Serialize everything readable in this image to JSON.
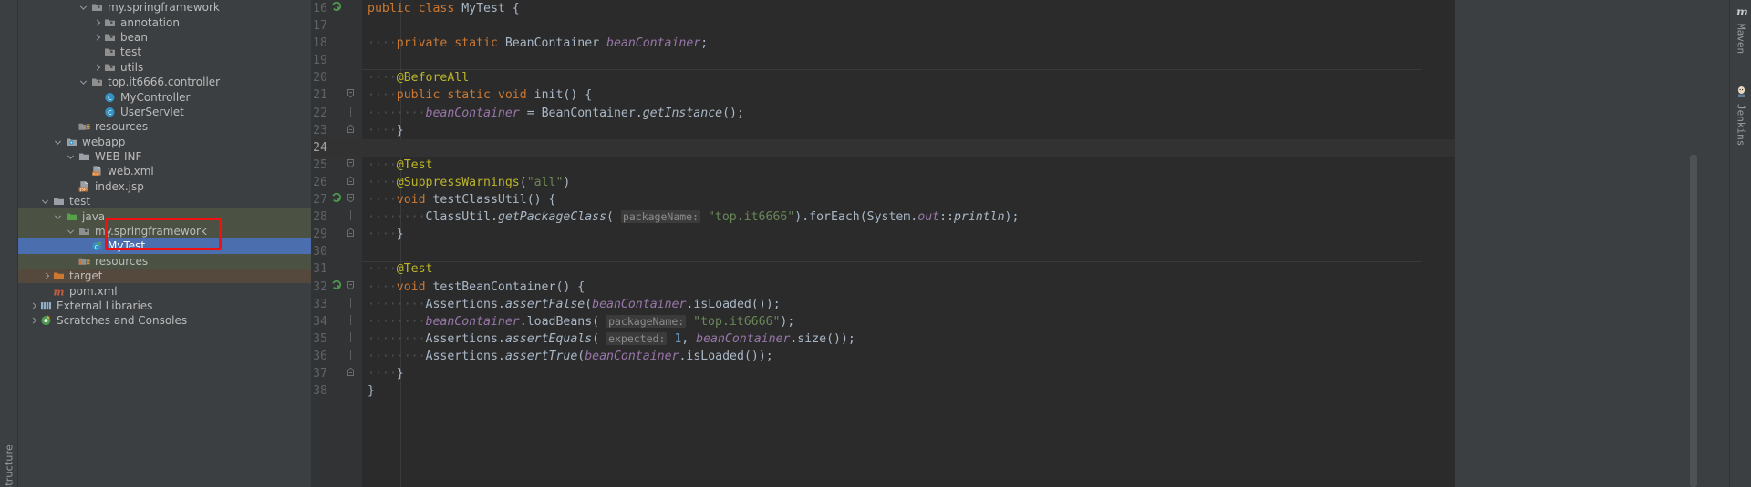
{
  "left_strip": {
    "structure_label": "Structure"
  },
  "project_tree": {
    "items": [
      {
        "indent": 4,
        "arrow": "open",
        "icon": "package-icon",
        "label": "my.springframework",
        "scope": "none",
        "selected": false
      },
      {
        "indent": 5,
        "arrow": "closed",
        "icon": "package-icon",
        "label": "annotation",
        "scope": "none",
        "selected": false
      },
      {
        "indent": 5,
        "arrow": "closed",
        "icon": "package-icon",
        "label": "bean",
        "scope": "none",
        "selected": false
      },
      {
        "indent": 5,
        "arrow": "none",
        "icon": "package-icon",
        "label": "test",
        "scope": "none",
        "selected": false
      },
      {
        "indent": 5,
        "arrow": "closed",
        "icon": "package-icon",
        "label": "utils",
        "scope": "none",
        "selected": false
      },
      {
        "indent": 4,
        "arrow": "open",
        "icon": "package-icon",
        "label": "top.it6666.controller",
        "scope": "none",
        "selected": false
      },
      {
        "indent": 5,
        "arrow": "none",
        "icon": "class-icon",
        "label": "MyController",
        "scope": "none",
        "selected": false
      },
      {
        "indent": 5,
        "arrow": "none",
        "icon": "class-icon",
        "label": "UserServlet",
        "scope": "none",
        "selected": false
      },
      {
        "indent": 3,
        "arrow": "none",
        "icon": "resources-icon",
        "label": "resources",
        "scope": "none",
        "selected": false
      },
      {
        "indent": 2,
        "arrow": "open",
        "icon": "webapp-icon",
        "label": "webapp",
        "scope": "none",
        "selected": false
      },
      {
        "indent": 3,
        "arrow": "open",
        "icon": "folder-icon",
        "label": "WEB-INF",
        "scope": "none",
        "selected": false
      },
      {
        "indent": 4,
        "arrow": "none",
        "icon": "xml-file-icon",
        "label": "web.xml",
        "scope": "none",
        "selected": false
      },
      {
        "indent": 3,
        "arrow": "none",
        "icon": "jsp-file-icon",
        "label": "index.jsp",
        "scope": "none",
        "selected": false
      },
      {
        "indent": 1,
        "arrow": "open",
        "icon": "folder-icon",
        "label": "test",
        "scope": "none",
        "selected": false
      },
      {
        "indent": 2,
        "arrow": "open",
        "icon": "source-root-icon",
        "label": "java",
        "scope": "test",
        "selected": false
      },
      {
        "indent": 3,
        "arrow": "open",
        "icon": "package-icon",
        "label": "my.springframework",
        "scope": "test",
        "selected": false
      },
      {
        "indent": 4,
        "arrow": "none",
        "icon": "test-class-icon",
        "label": "MyTest",
        "scope": "test",
        "selected": true
      },
      {
        "indent": 3,
        "arrow": "none",
        "icon": "test-resources-icon",
        "label": "resources",
        "scope": "test",
        "selected": false
      },
      {
        "indent": 1,
        "arrow": "closed",
        "icon": "excluded-folder-icon",
        "label": "target",
        "scope": "target",
        "selected": false
      },
      {
        "indent": 1,
        "arrow": "none",
        "icon": "maven-file-icon",
        "label": "pom.xml",
        "scope": "none",
        "selected": false
      },
      {
        "indent": 0,
        "arrow": "closed",
        "icon": "library-icon",
        "label": "External Libraries",
        "scope": "none",
        "selected": false
      },
      {
        "indent": 0,
        "arrow": "closed",
        "icon": "scratches-icon",
        "label": "Scratches and Consoles",
        "scope": "none",
        "selected": false
      }
    ],
    "annotation": {
      "type": "red-rectangle",
      "color": "#ee1111"
    }
  },
  "editor": {
    "caret_line": 24,
    "first_line": 16,
    "lines": [
      {
        "n": 16,
        "run": true,
        "fold": "none",
        "html": "<span class=\"kw\">public class </span><span class=\"cls\">MyTest </span><span class=\"punc\">{</span>"
      },
      {
        "n": 17,
        "run": false,
        "fold": "none",
        "html": ""
      },
      {
        "n": 18,
        "run": false,
        "fold": "none",
        "html": "<span class=\"ind\">····</span><span class=\"kw\">private static </span><span class=\"cls\">BeanContainer </span><span class=\"fld\">beanContainer</span><span class=\"punc\">;</span>"
      },
      {
        "n": 19,
        "run": false,
        "fold": "none",
        "html": ""
      },
      {
        "n": 20,
        "run": false,
        "fold": "none",
        "html": "<span class=\"ind\">····</span><span class=\"ann\">@BeforeAll</span>"
      },
      {
        "n": 21,
        "run": false,
        "fold": "open",
        "html": "<span class=\"ind\">····</span><span class=\"kw\">public static void </span><span class=\"cls\">init</span><span class=\"punc\">() {</span>"
      },
      {
        "n": 22,
        "run": false,
        "fold": "bar",
        "html": "<span class=\"ind\">····</span><span class=\"ind\">····</span><span class=\"fld\">beanContainer</span><span class=\"punc\"> = </span><span class=\"cls\">BeanContainer.</span><span class=\"mth\">getInstance</span><span class=\"punc\">();</span>"
      },
      {
        "n": 23,
        "run": false,
        "fold": "close",
        "html": "<span class=\"ind\">····</span><span class=\"punc\">}</span>"
      },
      {
        "n": 24,
        "run": false,
        "fold": "none",
        "html": ""
      },
      {
        "n": 25,
        "run": false,
        "fold": "open",
        "html": "<span class=\"ind\">····</span><span class=\"ann\">@Test</span>"
      },
      {
        "n": 26,
        "run": false,
        "fold": "close",
        "html": "<span class=\"ind\">····</span><span class=\"ann\">@SuppressWarnings</span><span class=\"punc\">(</span><span class=\"str\">\"all\"</span><span class=\"punc\">)</span>"
      },
      {
        "n": 27,
        "run": true,
        "fold": "open",
        "html": "<span class=\"ind\">····</span><span class=\"kw\">void </span><span class=\"cls\">testClassUtil</span><span class=\"punc\">() {</span>"
      },
      {
        "n": 28,
        "run": false,
        "fold": "bar",
        "html": "<span class=\"ind\">····</span><span class=\"ind\">····</span><span class=\"cls\">ClassUtil.</span><span class=\"mth\">getPackageClass</span><span class=\"punc\">(</span> <span class=\"hint\">packageName:</span> <span class=\"str\">\"top.it6666\"</span><span class=\"punc\">).forEach(</span><span class=\"cls\">System.</span><span class=\"fld\">out</span><span class=\"punc\">::</span><span class=\"mth\">println</span><span class=\"punc\">);</span>"
      },
      {
        "n": 29,
        "run": false,
        "fold": "close",
        "html": "<span class=\"ind\">····</span><span class=\"punc\">}</span>"
      },
      {
        "n": 30,
        "run": false,
        "fold": "none",
        "html": ""
      },
      {
        "n": 31,
        "run": false,
        "fold": "none",
        "html": "<span class=\"ind\">····</span><span class=\"ann\">@Test</span>"
      },
      {
        "n": 32,
        "run": true,
        "fold": "open",
        "html": "<span class=\"ind\">····</span><span class=\"kw\">void </span><span class=\"cls\">testBeanContainer</span><span class=\"punc\">() {</span>"
      },
      {
        "n": 33,
        "run": false,
        "fold": "bar",
        "html": "<span class=\"ind\">····</span><span class=\"ind\">····</span><span class=\"cls\">Assertions.</span><span class=\"mth\">assertFalse</span><span class=\"punc\">(</span><span class=\"fld\">beanContainer</span><span class=\"punc\">.</span><span class=\"cls\">isLoaded</span><span class=\"punc\">());</span>"
      },
      {
        "n": 34,
        "run": false,
        "fold": "bar",
        "html": "<span class=\"ind\">····</span><span class=\"ind\">····</span><span class=\"fld\">beanContainer</span><span class=\"punc\">.</span><span class=\"cls\">loadBeans</span><span class=\"punc\">(</span> <span class=\"hint\">packageName:</span> <span class=\"str\">\"top.it6666\"</span><span class=\"punc\">);</span>"
      },
      {
        "n": 35,
        "run": false,
        "fold": "bar",
        "html": "<span class=\"ind\">····</span><span class=\"ind\">····</span><span class=\"cls\">Assertions.</span><span class=\"mth\">assertEquals</span><span class=\"punc\">(</span> <span class=\"hint\">expected:</span> <span class=\"num2\">1</span><span class=\"punc\">, </span><span class=\"fld\">beanContainer</span><span class=\"punc\">.</span><span class=\"cls\">size</span><span class=\"punc\">());</span>"
      },
      {
        "n": 36,
        "run": false,
        "fold": "bar",
        "html": "<span class=\"ind\">····</span><span class=\"ind\">····</span><span class=\"cls\">Assertions.</span><span class=\"mth\">assertTrue</span><span class=\"punc\">(</span><span class=\"fld\">beanContainer</span><span class=\"punc\">.</span><span class=\"cls\">isLoaded</span><span class=\"punc\">());</span>"
      },
      {
        "n": 37,
        "run": false,
        "fold": "close",
        "html": "<span class=\"ind\">····</span><span class=\"punc\">}</span>"
      },
      {
        "n": 38,
        "run": false,
        "fold": "none",
        "html": "<span class=\"punc\">}</span>"
      }
    ]
  },
  "right_strip": {
    "tabs": [
      {
        "label": "Maven",
        "icon": "maven-icon"
      },
      {
        "label": "Jenkins",
        "icon": "jenkins-icon"
      }
    ]
  },
  "colors": {
    "editor_bg": "#2b2b2b",
    "panel_bg": "#3c3f41",
    "gutter_bg": "#313335",
    "selection_blue": "#4b6eaf",
    "test_scope_green": "#4b5244",
    "target_scope_brown": "#55483c",
    "annotation_red": "#ee1111",
    "keyword_orange": "#cc7832",
    "field_purple": "#9876aa",
    "string_green": "#6a8759",
    "annotation_yellow": "#bbb529",
    "number_blue": "#6897bb"
  }
}
